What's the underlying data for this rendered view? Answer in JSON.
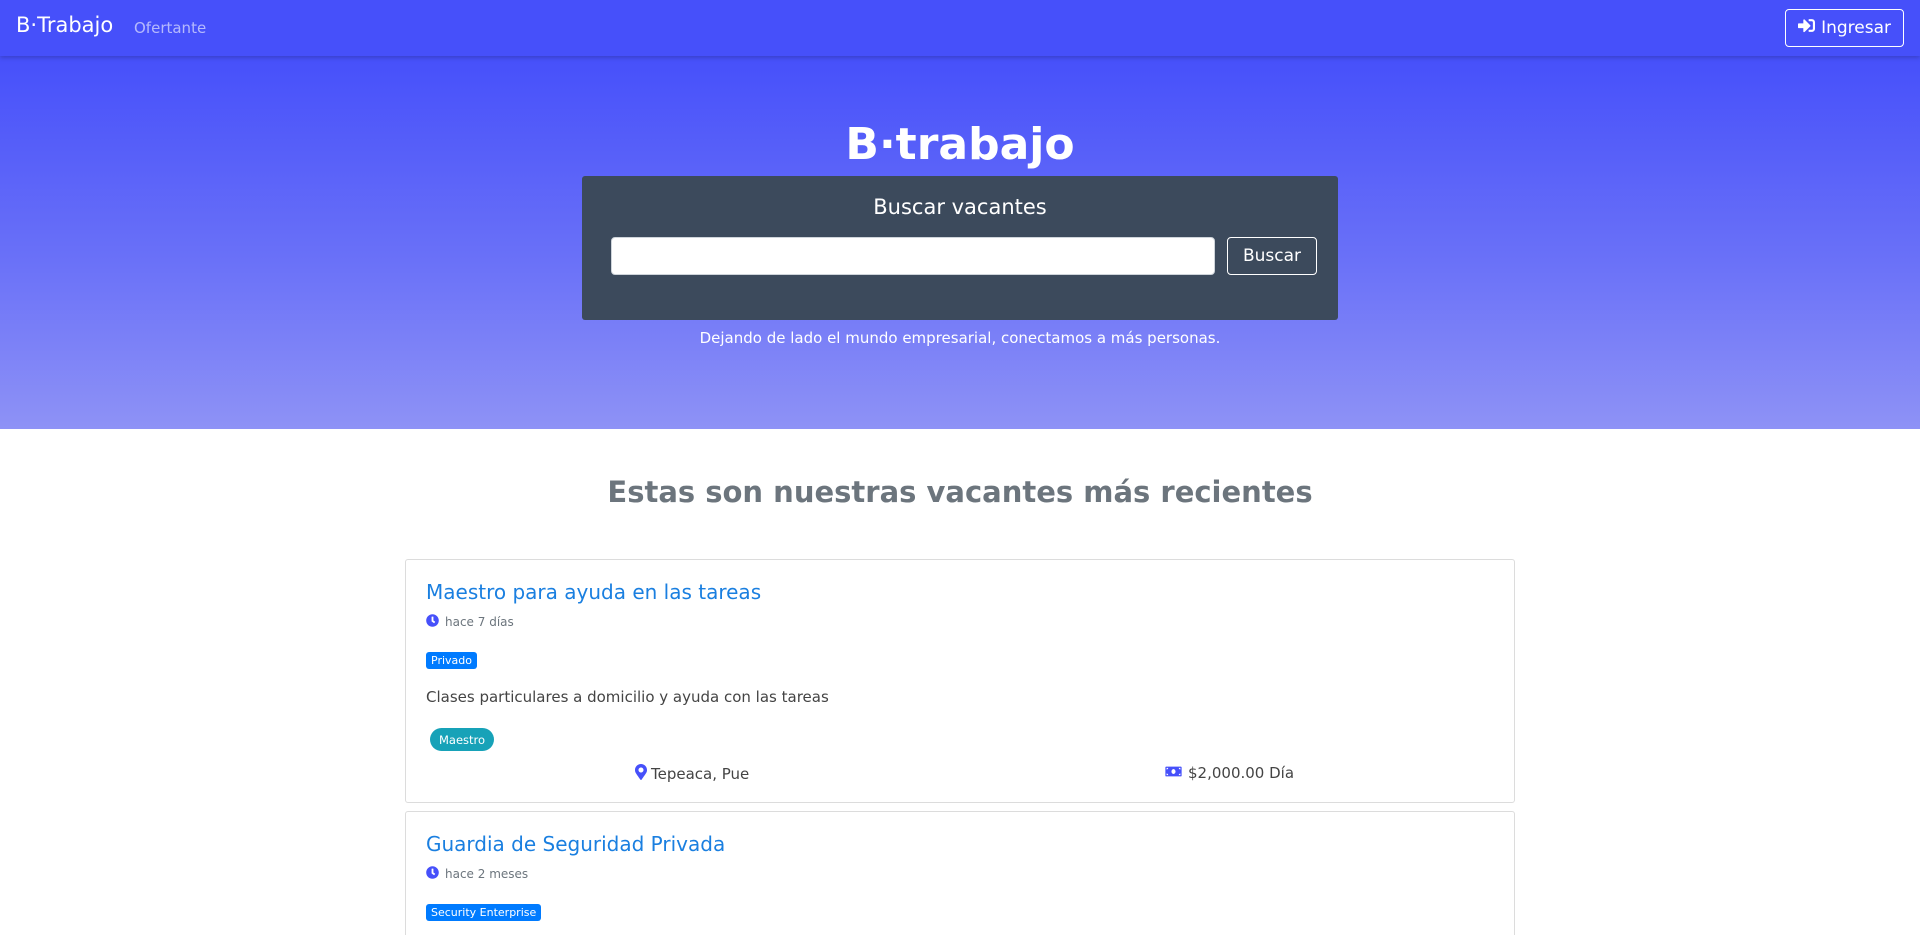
{
  "navbar": {
    "brand": "B·Trabajo",
    "link": "Ofertante",
    "login_label": "Ingresar"
  },
  "hero": {
    "title": "B·trabajo",
    "search_heading": "Buscar vacantes",
    "search_value": "",
    "search_button": "Buscar",
    "tagline": "Dejando de lado el mundo empresarial, conectamos a más personas."
  },
  "section": {
    "title": "Estas son nuestras vacantes más recientes"
  },
  "jobs": [
    {
      "title": "Maestro para ayuda en las tareas",
      "time": "hace 7 días",
      "company": "Privado",
      "description": "Clases particulares a domicilio y ayuda con las tareas",
      "tag": "Maestro",
      "location": "Tepeaca, Pue",
      "salary": "$2,000.00 Día"
    },
    {
      "title": "Guardia de Seguridad Privada",
      "time": "hace 2 meses",
      "company": "Security Enterprise"
    }
  ],
  "colors": {
    "primary": "#4650fa",
    "card_dark": "#3c4a5c",
    "link_blue": "#1a7fe0",
    "badge_blue": "#007bff",
    "tag_teal": "#17a2b8"
  },
  "icons": {
    "login": "sign-in-icon",
    "clock": "clock-icon",
    "location": "map-marker-icon",
    "salary": "money-bill-icon"
  }
}
